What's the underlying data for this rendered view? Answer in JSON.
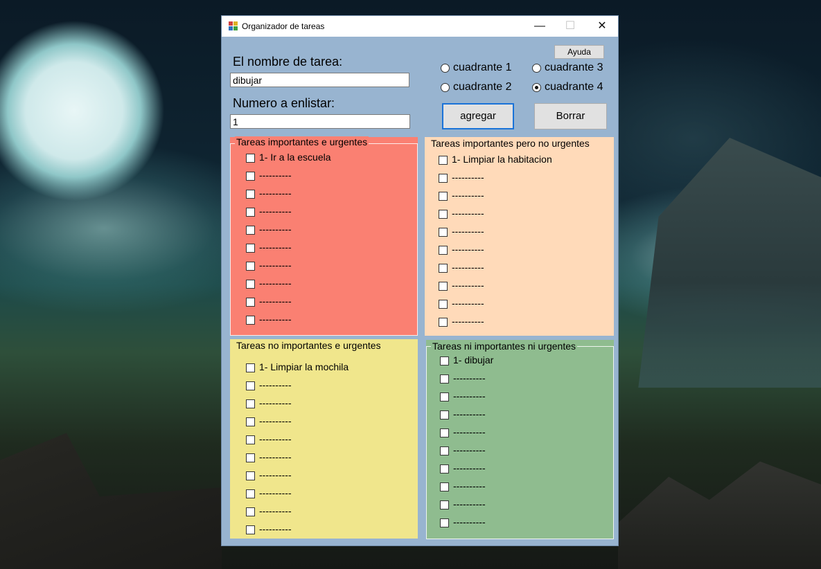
{
  "window": {
    "title": "Organizador de tareas"
  },
  "titlebar": {
    "min": "—",
    "max": "☐",
    "close": "✕"
  },
  "form": {
    "nombre_label": "El nombre de tarea:",
    "nombre_value": "dibujar",
    "numero_label": "Numero a enlistar:",
    "numero_value": "1",
    "ayuda_label": "Ayuda",
    "agregar_label": "agregar",
    "borrar_label": "Borrar",
    "radios": [
      {
        "label": "cuadrante 1",
        "checked": false
      },
      {
        "label": "cuadrante 2",
        "checked": false
      },
      {
        "label": "cuadrante 3",
        "checked": false
      },
      {
        "label": "cuadrante 4",
        "checked": true
      }
    ]
  },
  "quadrants": [
    {
      "title": "Tareas importantes e urgentes",
      "color": "#fa8072",
      "items": [
        "1- Ir a la escuela",
        "----------",
        "----------",
        "----------",
        "----------",
        "----------",
        "----------",
        "----------",
        "----------",
        "----------"
      ]
    },
    {
      "title": "Tareas importantes pero no urgentes",
      "color": "#ffdab9",
      "items": [
        "1- Limpiar la habitacion",
        "----------",
        "----------",
        "----------",
        "----------",
        "----------",
        "----------",
        "----------",
        "----------",
        "----------"
      ]
    },
    {
      "title": "Tareas no importantes e urgentes",
      "color": "#f0e68c",
      "items": [
        "1- Limpiar la mochila",
        "----------",
        "----------",
        "----------",
        "----------",
        "----------",
        "----------",
        "----------",
        "----------",
        "----------"
      ]
    },
    {
      "title": "Tareas ni importantes ni urgentes",
      "color": "#8fbc8f",
      "items": [
        "1- dibujar",
        "----------",
        "----------",
        "----------",
        "----------",
        "----------",
        "----------",
        "----------",
        "----------",
        "----------"
      ]
    }
  ]
}
